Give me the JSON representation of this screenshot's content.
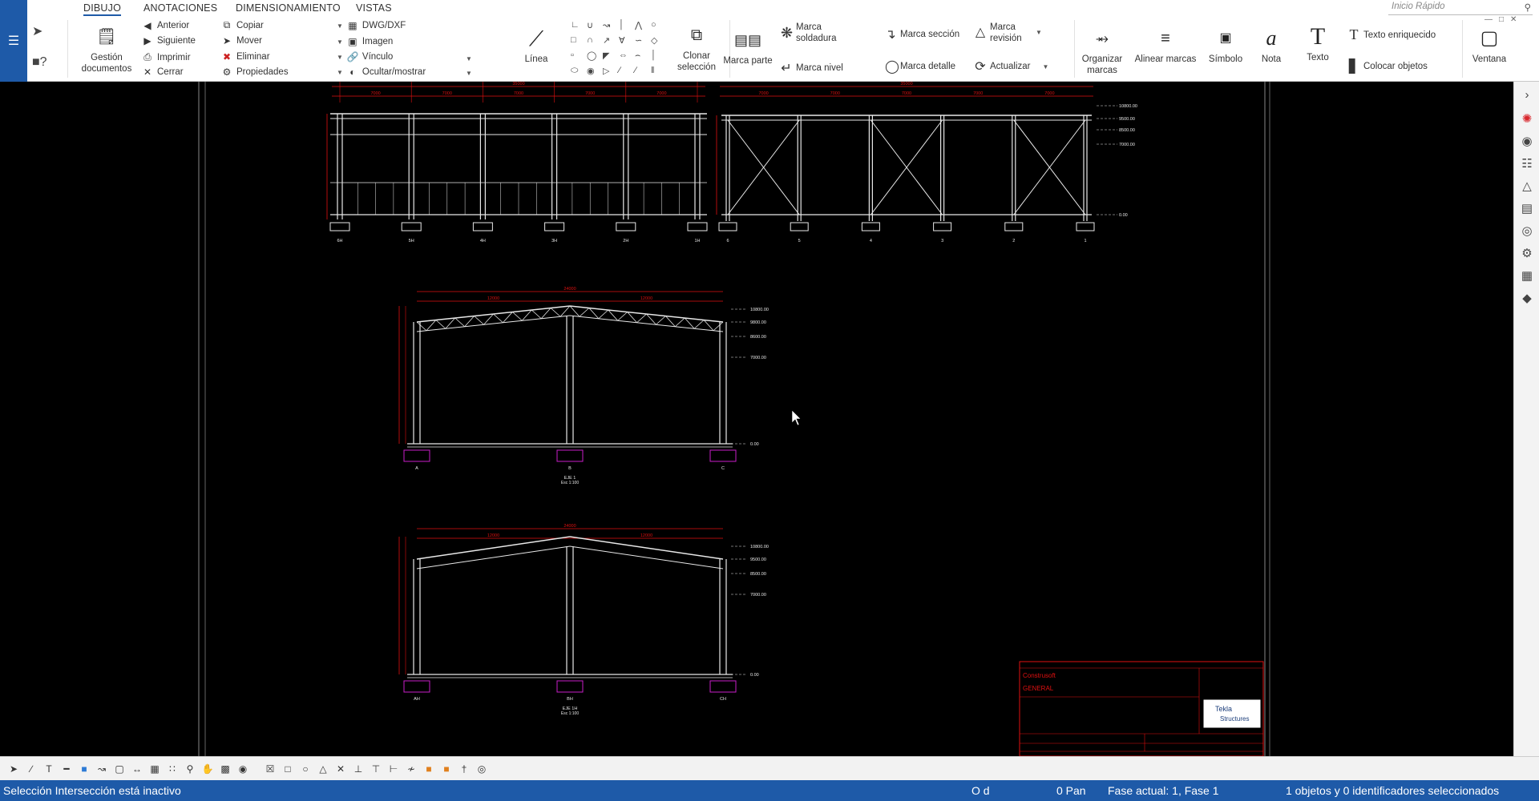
{
  "tabs": [
    {
      "label": "DIBUJO",
      "active": true
    },
    {
      "label": "ANOTACIONES",
      "active": false
    },
    {
      "label": "DIMENSIONAMIENTO",
      "active": false
    },
    {
      "label": "VISTAS",
      "active": false
    }
  ],
  "quick_search": {
    "placeholder": "Inicio Rápido"
  },
  "ribbon": {
    "gestion": "Gestión documentos",
    "anterior": "Anterior",
    "siguiente": "Siguiente",
    "imprimir": "Imprimir",
    "cerrar": "Cerrar",
    "copiar": "Copiar",
    "mover": "Mover",
    "eliminar": "Eliminar",
    "propiedades": "Propiedades",
    "dwg": "DWG/DXF",
    "imagen": "Imagen",
    "vinculo": "Vínculo",
    "ocultar": "Ocultar/mostrar",
    "linea": "Línea",
    "clonar": "Clonar selección",
    "marca_parte": "Marca parte",
    "marca_soldadura": "Marca soldadura",
    "marca_nivel": "Marca nivel",
    "marca_seccion": "Marca sección",
    "marca_detalle": "Marca detalle",
    "marca_revision": "Marca revisión",
    "actualizar": "Actualizar",
    "organizar": "Organizar marcas",
    "alinear": "Alinear marcas",
    "simbolo": "Símbolo",
    "nota": "Nota",
    "texto": "Texto",
    "texto_enriquecido": "Texto enriquecido",
    "colocar_objetos": "Colocar objetos",
    "ventana": "Ventana"
  },
  "drawing": {
    "elev1": {
      "top_dim": "35000",
      "bays": [
        "7000",
        "7000",
        "7000",
        "7000",
        "7000"
      ],
      "axes": [
        "6H",
        "5H",
        "4H",
        "3H",
        "2H",
        "1H"
      ]
    },
    "elev2": {
      "top_dim": "35000",
      "bays": [
        "7000",
        "7000",
        "7000",
        "7000",
        "7000"
      ],
      "axes": [
        "6",
        "5",
        "4",
        "3",
        "2",
        "1"
      ],
      "levels": [
        "10800.00",
        "9500.00",
        "8500.00",
        "7000.00",
        "0.00"
      ]
    },
    "frame1": {
      "top_dim": "24000",
      "half_dims": [
        "12000",
        "12000"
      ],
      "levels": [
        "10800.00",
        "9800.00",
        "8600.00",
        "7000.00",
        "0.00"
      ],
      "axes": [
        "A",
        "B",
        "C"
      ],
      "caption": "EJE 1",
      "scale": "Esc 1:100"
    },
    "frame2": {
      "top_dim": "24000",
      "half_dims": [
        "12000",
        "12000"
      ],
      "levels": [
        "10800.00",
        "9500.00",
        "8500.00",
        "7000.00",
        "0.00"
      ],
      "axes": [
        "AH",
        "BH",
        "CH"
      ],
      "caption": "EJE 1H",
      "scale": "Esc 1:100"
    },
    "titleblock": {
      "company": "Construsoft",
      "title": "GENERAL",
      "logo_line1": "Tekla",
      "logo_line2": "Structures"
    }
  },
  "status": {
    "left": "Selección Intersección está  inactivo",
    "od": "O d",
    "pan": "0  Pan",
    "fase": "Fase actual: 1, Fase 1",
    "selected": "1 objetos y 0 identificadores seleccionados"
  },
  "colors": {
    "accent": "#1e5aa8",
    "canvas": "#000000",
    "dim_red": "#e01010",
    "footing_magenta": "#c81ec8"
  }
}
